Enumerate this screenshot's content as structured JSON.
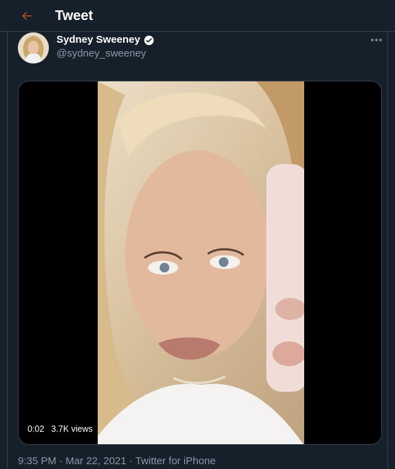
{
  "header": {
    "title": "Tweet",
    "back_icon": "arrow-left-icon",
    "accent_color": "#e0571d"
  },
  "author": {
    "name": "Sydney Sweeney",
    "handle": "@sydney_sweeney",
    "verified_icon": "verified-badge-icon"
  },
  "more_icon": "more-horizontal-icon",
  "video": {
    "elapsed": "0:02",
    "views": "3.7K views"
  },
  "tweet": {
    "time": "9:35 PM",
    "date": "Mar 22, 2021",
    "separator": "·",
    "source": "Twitter for iPhone"
  },
  "colors": {
    "background": "#15202b",
    "border": "#38444d",
    "secondary_text": "#8899a6"
  }
}
